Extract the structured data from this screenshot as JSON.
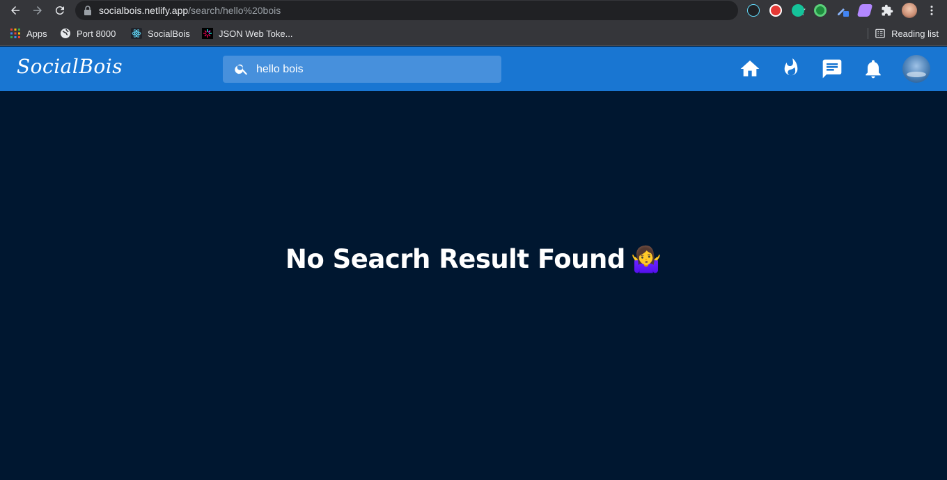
{
  "browser": {
    "url_host": "socialbois.netlify.app",
    "url_path": "/search/hello%20bois",
    "bookmarks": [
      {
        "label": "Apps",
        "icon": "apps-grid-icon"
      },
      {
        "label": "Port 8000",
        "icon": "globe-icon"
      },
      {
        "label": "SocialBois",
        "icon": "react-icon"
      },
      {
        "label": "JSON Web Toke...",
        "icon": "jwt-icon"
      }
    ],
    "reading_list": "Reading list"
  },
  "header": {
    "logo": "SocialBois",
    "search_value": "hello bois",
    "icons": [
      "home-icon",
      "fire-icon",
      "chat-icon",
      "bell-icon"
    ],
    "color": "#1976d2"
  },
  "main": {
    "message": "No Seacrh Result Found",
    "emoji": "🤷‍♀️",
    "background": "#001730"
  }
}
